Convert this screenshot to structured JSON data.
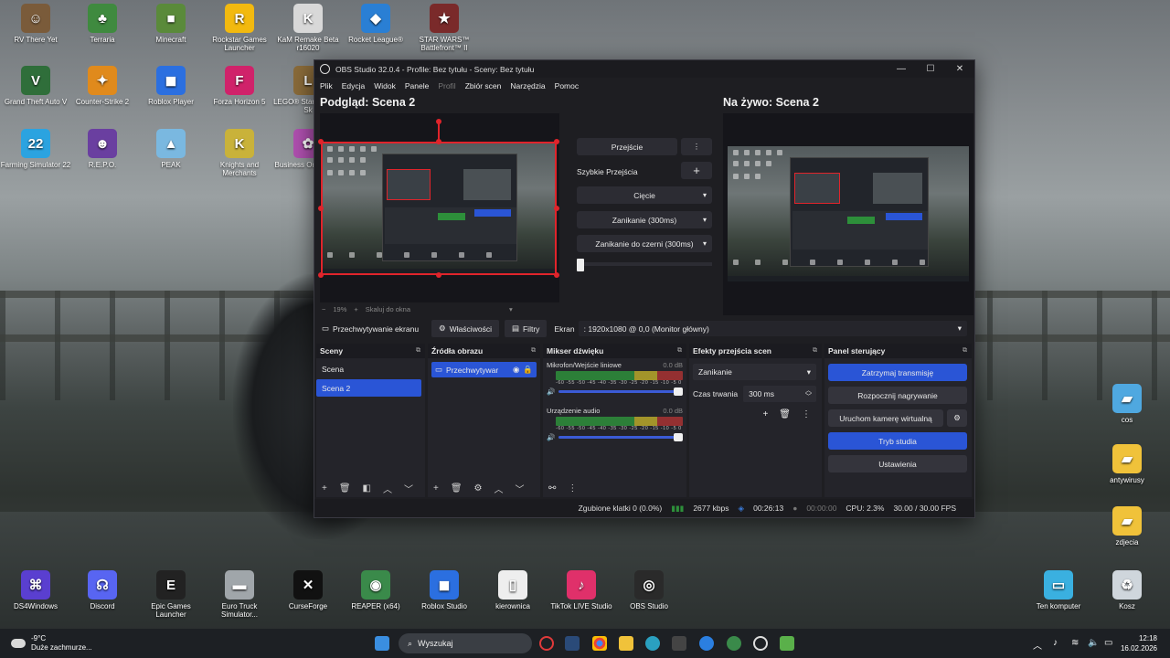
{
  "desktop_icons": [
    {
      "label": "RV There Yet",
      "color": "#7a5b3a",
      "glyph": "☺"
    },
    {
      "label": "Terraria",
      "color": "#3f8a3f",
      "glyph": "♣"
    },
    {
      "label": "Minecraft",
      "color": "#5a8a3a",
      "glyph": "■"
    },
    {
      "label": "Rockstar Games Launcher",
      "color": "#f2b90f",
      "glyph": "R"
    },
    {
      "label": "KaM Remake Beta r16020",
      "color": "#d8d8d8",
      "glyph": "K"
    },
    {
      "label": "Rocket League®",
      "color": "#2a7fd4",
      "glyph": "◆"
    },
    {
      "label": "STAR WARS™ Battlefront™ II",
      "color": "#7a2a2a",
      "glyph": "★"
    },
    {
      "label": "Grand Theft Auto V",
      "color": "#2f6e3a",
      "glyph": "V"
    },
    {
      "label": "Counter-Strike 2",
      "color": "#e08a1c",
      "glyph": "✦"
    },
    {
      "label": "Roblox Player",
      "color": "#2b6fe0",
      "glyph": "◼"
    },
    {
      "label": "Forza Horizon 5",
      "color": "#d0226a",
      "glyph": "F"
    },
    {
      "label": "LEGO® Star Wars™: Sk",
      "color": "#8a6b3a",
      "glyph": "L"
    },
    {
      "label": "Farming Simulator 22",
      "color": "#2ba3e0",
      "glyph": "22"
    },
    {
      "label": "R.E.P.O.",
      "color": "#6a3fa0",
      "glyph": "☻"
    },
    {
      "label": "PEAK",
      "color": "#7ab8e0",
      "glyph": "▲"
    },
    {
      "label": "Knights and Merchants",
      "color": "#c9b23a",
      "glyph": "K"
    },
    {
      "label": "Business Online Mul",
      "color": "#b050b0",
      "glyph": "✿"
    },
    {
      "label": "DS4Windows",
      "color": "#5a3fd0",
      "glyph": "⌘"
    },
    {
      "label": "Discord",
      "color": "#5865f2",
      "glyph": "☊"
    },
    {
      "label": "Epic Games Launcher",
      "color": "#222222",
      "glyph": "E"
    },
    {
      "label": "Euro Truck Simulator...",
      "color": "#a0a6aa",
      "glyph": "▬"
    },
    {
      "label": "CurseForge",
      "color": "#111111",
      "glyph": "✕"
    },
    {
      "label": "REAPER (x64)",
      "color": "#3a8a4a",
      "glyph": "◉"
    },
    {
      "label": "Roblox Studio",
      "color": "#2b6fe0",
      "glyph": "◼"
    },
    {
      "label": "kierownica",
      "color": "#eeeeee",
      "glyph": "▯"
    },
    {
      "label": "TikTok LIVE Studio",
      "color": "#e0306a",
      "glyph": "♪"
    },
    {
      "label": "OBS Studio",
      "color": "#2a2a2a",
      "glyph": "◎"
    },
    {
      "label": "Ten komputer",
      "color": "#3ab0e0",
      "glyph": "▭"
    },
    {
      "label": "Kosz",
      "color": "#cfd6dc",
      "glyph": "♻"
    },
    {
      "label": "cos",
      "color": "#4fa8e0",
      "glyph": "▰"
    },
    {
      "label": "antywirusy",
      "color": "#f0c23a",
      "glyph": "▰"
    },
    {
      "label": "zdjecia",
      "color": "#f0c23a",
      "glyph": "▰"
    }
  ],
  "obs": {
    "title": "OBS Studio 32.0.4 - Profile: Bez tytułu - Sceny: Bez tytułu",
    "menu": [
      "Plik",
      "Edycja",
      "Widok",
      "Panele",
      "Profil",
      "Zbiór scen",
      "Narzędzia",
      "Pomoc"
    ],
    "preview_title": "Podgląd: Scena 2",
    "live_title": "Na żywo: Scena 2",
    "zoom_minus": "−",
    "zoom_value": "19%",
    "zoom_plus": "+",
    "zoom_fit": "Skaluj do okna",
    "transition_button": "Przejście",
    "quick_transitions": "Szybkie Przejścia",
    "quick_items": [
      "Cięcie",
      "Zanikanie (300ms)",
      "Zanikanie do czerni (300ms)"
    ],
    "source_name": "Przechwytywanie ekranu",
    "properties_btn": "Właściwości",
    "filters_btn": "Filtry",
    "screen_label": "Ekran",
    "screen_value": ": 1920x1080 @ 0,0 (Monitor główny)",
    "docks": {
      "scenes_title": "Sceny",
      "scenes": [
        "Scena",
        "Scena 2"
      ],
      "sources_title": "Źródła obrazu",
      "source_item": "Przechwytywar",
      "mixer_title": "Mikser dźwięku",
      "mixer_channels": [
        {
          "name": "Mikrofon/Wejście liniowe",
          "db": "0.0 dB"
        },
        {
          "name": "Urządzenie audio",
          "db": "0.0 dB"
        }
      ],
      "meter_ticks": "-60 -55 -50 -45 -40 -35 -30 -25 -20 -15 -10 -5 0",
      "fx_title": "Efekty przejścia scen",
      "fx_selected": "Zanikanie",
      "fx_duration_label": "Czas trwania",
      "fx_duration_value": "300 ms",
      "control_title": "Panel sterujący",
      "control_buttons": [
        "Zatrzymaj transmisję",
        "Rozpocznij nagrywanie",
        "Uruchom kamerę wirtualną",
        "Tryb studia",
        "Ustawienia"
      ]
    },
    "status": {
      "dropped": "Zgubione klatki 0 (0.0%)",
      "bitrate": "2677 kbps",
      "stream_time": "00:26:13",
      "rec_time": "00:00:00",
      "cpu": "CPU: 2.3%",
      "fps": "30.00 / 30.00 FPS"
    }
  },
  "taskbar": {
    "temp": "-9°C",
    "weather": "Duże zachmurze...",
    "search_placeholder": "Wyszukaj",
    "time": "12:18",
    "date": "16.02.2026"
  },
  "colors": {
    "accent": "#2a55d6",
    "selection": "#e0242b"
  }
}
